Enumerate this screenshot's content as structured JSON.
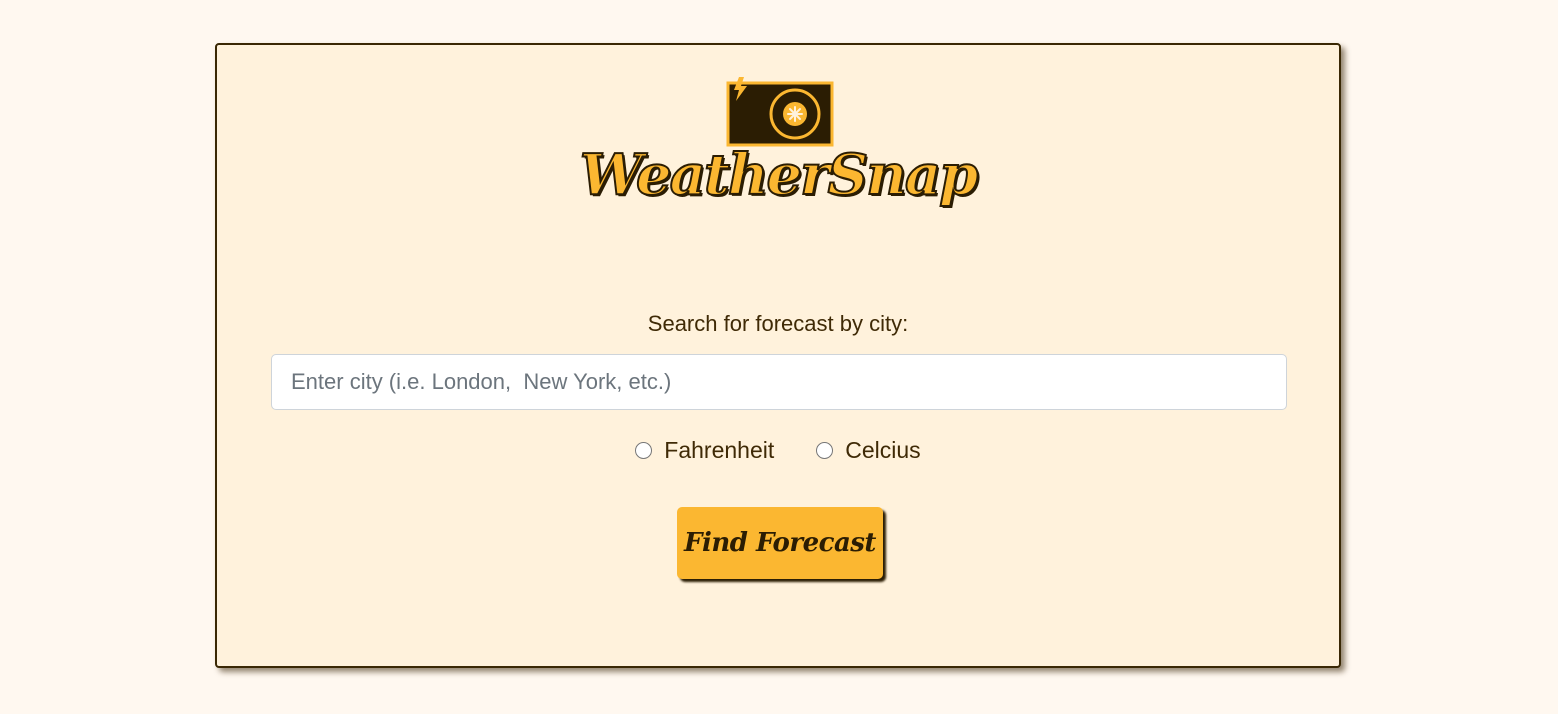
{
  "brand": {
    "name": "WeatherSnap",
    "logo_icon": "camera-sun-icon",
    "colors": {
      "accent": "#fbb731",
      "dark": "#2b1d03",
      "card_bg": "#fff2dc",
      "page_bg": "#fff8f0"
    }
  },
  "search": {
    "label": "Search for forecast by city:",
    "placeholder": "Enter city (i.e. London,  New York, etc.)",
    "value": ""
  },
  "units": {
    "options": [
      {
        "label": "Fahrenheit",
        "selected": false
      },
      {
        "label": "Celcius",
        "selected": false
      }
    ]
  },
  "actions": {
    "submit_label": "Find Forecast"
  }
}
